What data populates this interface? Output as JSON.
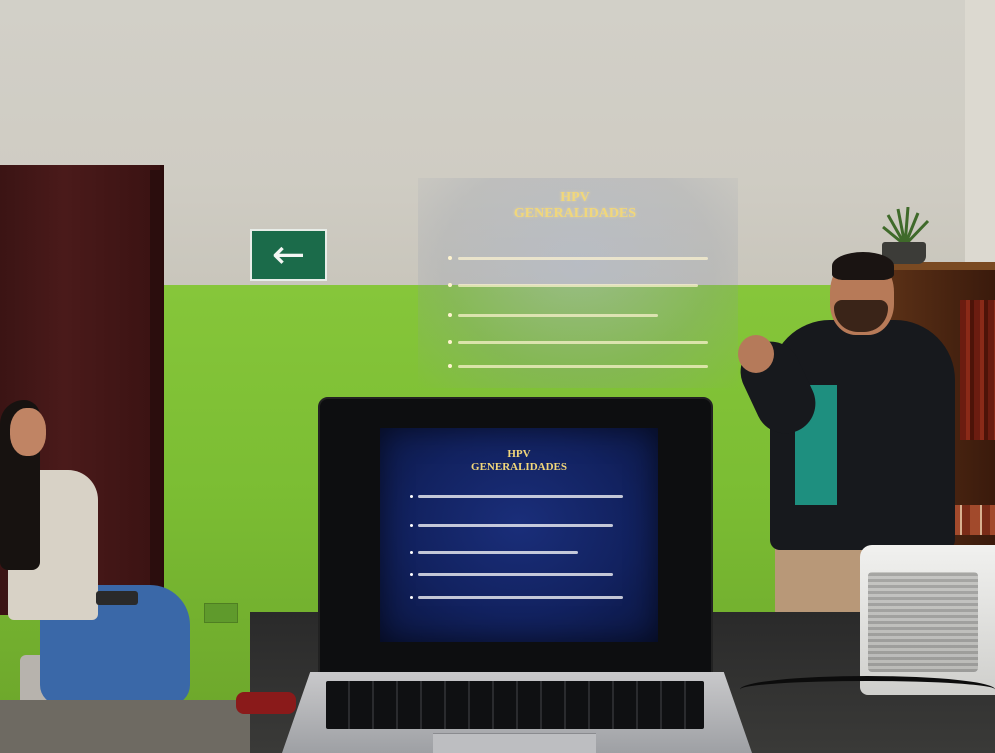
{
  "scene": {
    "projected_slide": {
      "title_line1": "HPV",
      "title_line2": "GENERALIDADES",
      "bullets": [
        {
          "width": 250
        },
        {
          "width": 240
        },
        {
          "width": 200
        },
        {
          "width": 250
        },
        {
          "width": 250
        }
      ]
    },
    "laptop_slide": {
      "title_line1": "HPV",
      "title_line2": "GENERALIDADES",
      "bullets": [
        {
          "width": 205
        },
        {
          "width": 195
        },
        {
          "width": 160
        },
        {
          "width": 195
        },
        {
          "width": 205
        }
      ]
    },
    "exit_sign": {
      "arrow": "←"
    },
    "colors": {
      "wall_green": "#7bbd33",
      "slide_background": "#122260",
      "slide_title": "#f2d77a",
      "exit_sign_green": "#1b6b4a"
    }
  }
}
